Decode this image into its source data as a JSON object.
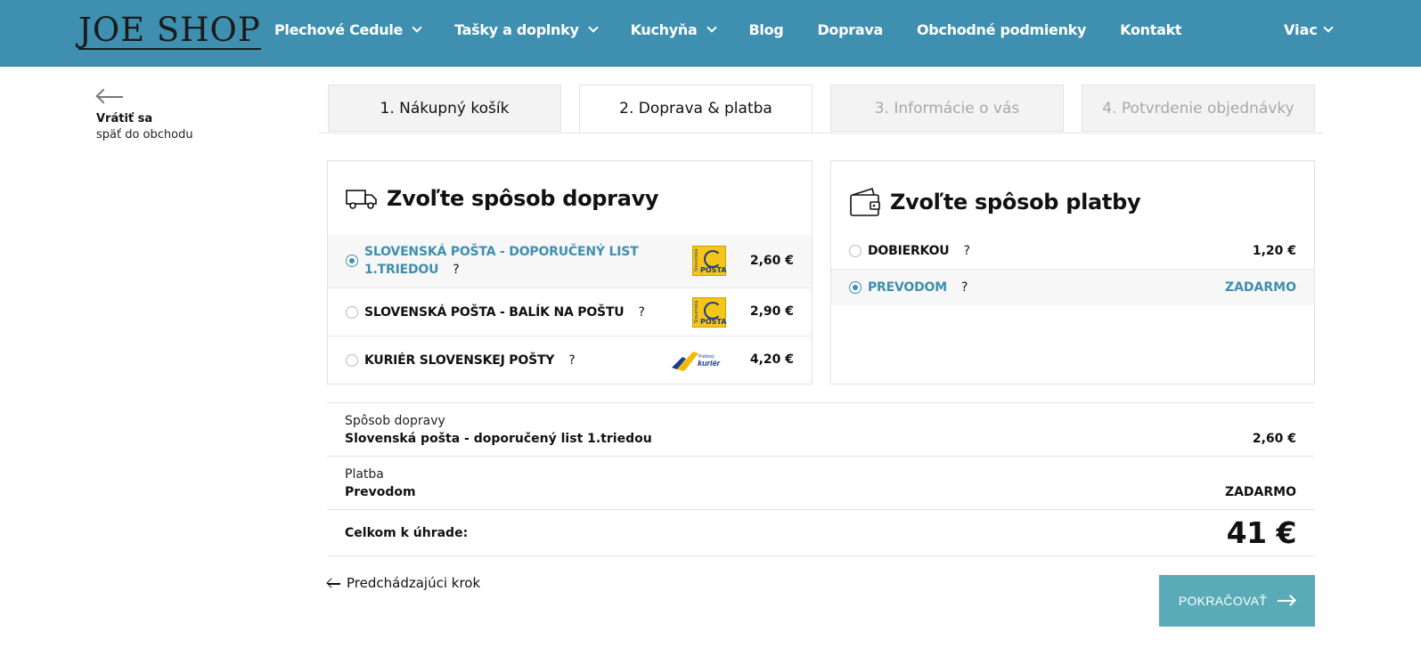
{
  "header": {
    "logo_text": "JOE SHOP",
    "nav": [
      {
        "label": "Plechové Cedule",
        "has_dropdown": true
      },
      {
        "label": "Tašky a doplnky",
        "has_dropdown": true
      },
      {
        "label": "Kuchyňa",
        "has_dropdown": true
      },
      {
        "label": "Blog",
        "has_dropdown": false
      },
      {
        "label": "Doprava",
        "has_dropdown": false
      },
      {
        "label": "Obchodné podmienky",
        "has_dropdown": false
      },
      {
        "label": "Kontakt",
        "has_dropdown": false
      }
    ],
    "more_label": "Viac"
  },
  "back": {
    "title": "Vrátiť sa",
    "subtitle": "späť do obchodu"
  },
  "steps": [
    {
      "label": "1. Nákupný košík",
      "state": "done"
    },
    {
      "label": "2. Doprava & platba",
      "state": "active"
    },
    {
      "label": "3. Informácie o vás",
      "state": "disabled"
    },
    {
      "label": "4. Potvrdenie objednávky",
      "state": "disabled"
    }
  ],
  "shipping": {
    "title": "Zvoľte spôsob dopravy",
    "options": [
      {
        "line1": "SLOVENSKÁ POŠTA - DOPORUČENÝ LIST",
        "line2": "1.TRIEDOU",
        "help": "?",
        "price": "2,60 €",
        "selected": true,
        "logo": "slovenska-posta"
      },
      {
        "line1": "SLOVENSKÁ POŠTA - BALÍK NA POŠTU",
        "help": "?",
        "price": "2,90 €",
        "selected": false,
        "logo": "slovenska-posta"
      },
      {
        "line1": "KURIÉR SLOVENSKEJ POŠTY",
        "help": "?",
        "price": "4,20 €",
        "selected": false,
        "logo": "kurier"
      }
    ],
    "posta_logo_small": "Slovenská",
    "posta_logo_label": "POŠTA",
    "kurier_logo_small": "Poštový",
    "kurier_logo_label": "kuriér"
  },
  "payment": {
    "title": "Zvoľte spôsob platby",
    "options": [
      {
        "label": "DOBIERKOU",
        "help": "?",
        "price": "1,20 €",
        "selected": false
      },
      {
        "label": "PREVODOM",
        "help": "?",
        "price": "ZADARMO",
        "selected": true
      }
    ]
  },
  "summary": {
    "shipping_label": "Spôsob dopravy",
    "shipping_value": "Slovenská pošta - doporučený list 1.triedou",
    "shipping_price": "2,60 €",
    "payment_label": "Platba",
    "payment_value": "Prevodom",
    "payment_price": "ZADARMO",
    "total_label": "Celkom k úhrade:",
    "total_price": "41 €"
  },
  "actions": {
    "prev_label": "Predchádzajúci krok",
    "continue_label": "POKRAČOVAŤ"
  },
  "colors": {
    "header_bg": "#3e8fb0",
    "accent": "#3e8fb0",
    "button_bg": "#5aabb8"
  }
}
